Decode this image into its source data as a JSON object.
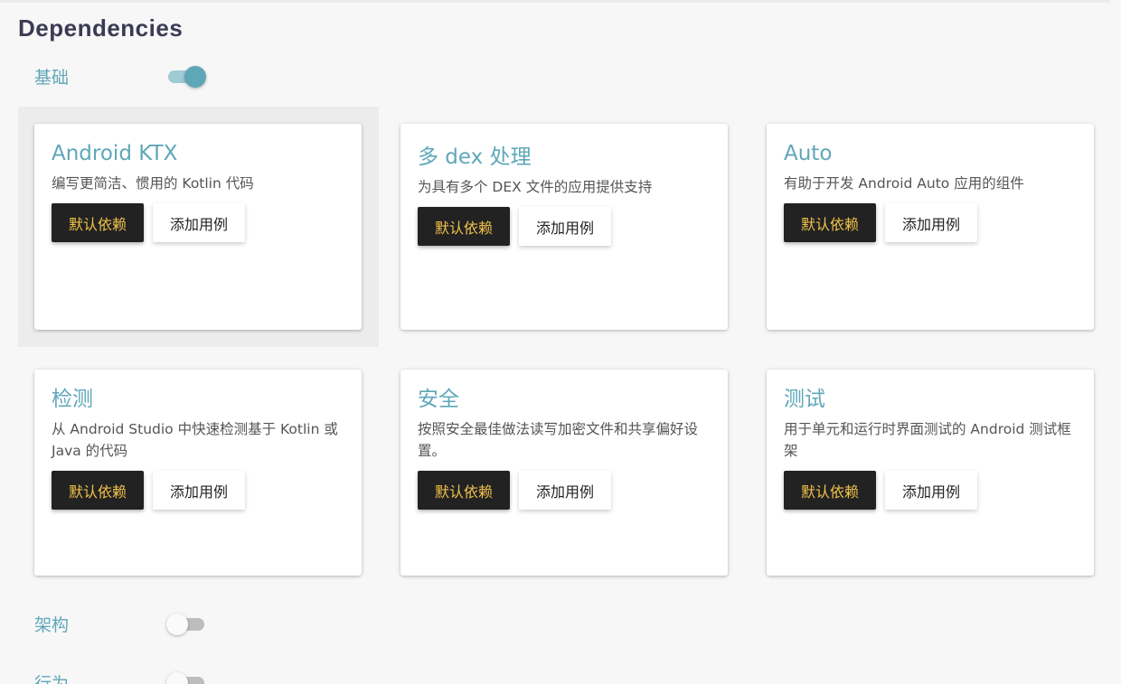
{
  "header": {
    "title": "Dependencies"
  },
  "sections": [
    {
      "label": "基础",
      "enabled": true
    },
    {
      "label": "架构",
      "enabled": false
    },
    {
      "label": "行为",
      "enabled": false
    }
  ],
  "cards": [
    {
      "title": "Android KTX",
      "description": "编写更简洁、惯用的 Kotlin 代码",
      "primary_label": "默认依赖",
      "secondary_label": "添加用例"
    },
    {
      "title": "多 dex 处理",
      "description": "为具有多个 DEX 文件的应用提供支持",
      "primary_label": "默认依赖",
      "secondary_label": "添加用例"
    },
    {
      "title": "Auto",
      "description": "有助于开发 Android Auto 应用的组件",
      "primary_label": "默认依赖",
      "secondary_label": "添加用例"
    },
    {
      "title": "检测",
      "description": "从 Android Studio 中快速检测基于 Kotlin 或 Java 的代码",
      "primary_label": "默认依赖",
      "secondary_label": "添加用例"
    },
    {
      "title": "安全",
      "description": "按照安全最佳做法读写加密文件和共享偏好设置。",
      "primary_label": "默认依赖",
      "secondary_label": "添加用例"
    },
    {
      "title": "测试",
      "description": "用于单元和运行时界面测试的 Android 测试框架",
      "primary_label": "默认依赖",
      "secondary_label": "添加用例"
    }
  ],
  "colors": {
    "accent": "#5fa7b8",
    "title": "#3c3b55",
    "primary_button_bg": "#222222",
    "primary_button_text": "#f1c24a",
    "background": "#f7f7f7"
  }
}
